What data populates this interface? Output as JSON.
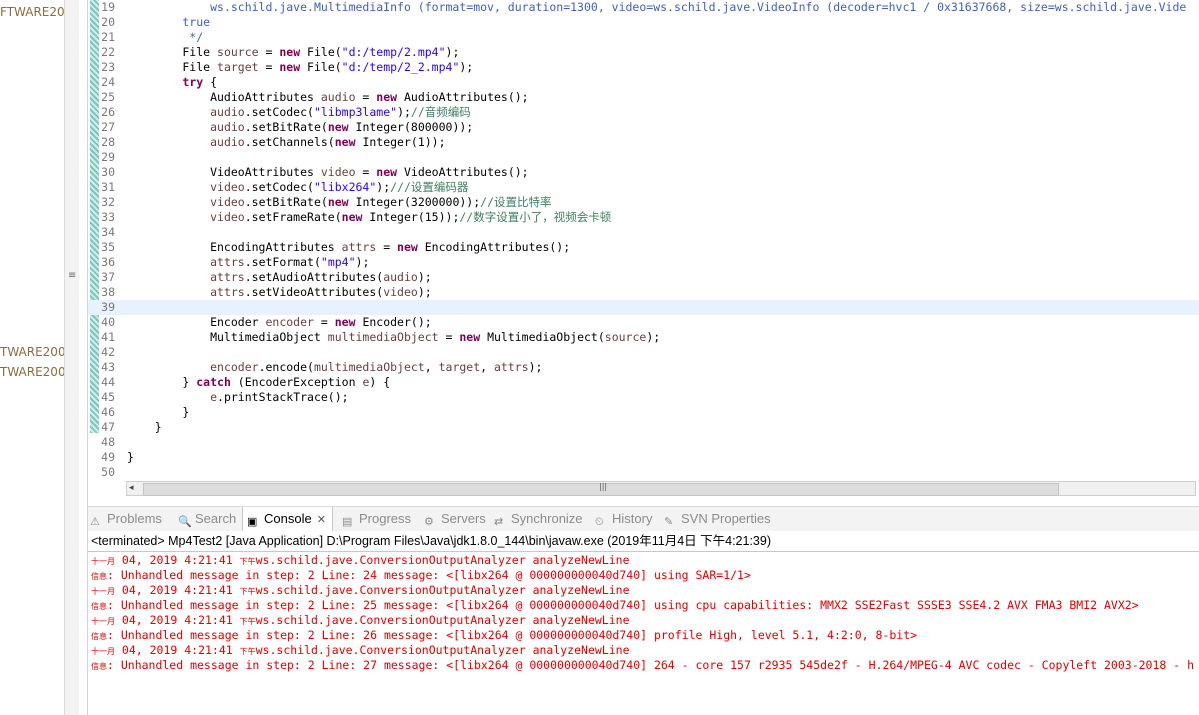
{
  "left_panel": {
    "labels": [
      "FTWARE20",
      "TWARE200",
      "TWARE200"
    ]
  },
  "editor": {
    "lines": [
      {
        "num": "19",
        "segs": [
          [
            "            ",
            ""
          ],
          [
            "ws.schild.jave.MultimediaInfo (format=mov, duration=1300, video=ws.schild.jave.VideoInfo (decoder=hvc1 / 0x31637668, size=ws.schild.jave.Vide",
            "jd"
          ]
        ]
      },
      {
        "num": "20",
        "segs": [
          [
            "        true",
            "jd"
          ]
        ]
      },
      {
        "num": "21",
        "segs": [
          [
            "         */",
            "jd"
          ]
        ]
      },
      {
        "num": "22",
        "segs": [
          [
            "        File ",
            ""
          ],
          [
            "source",
            "var"
          ],
          [
            " = ",
            ""
          ],
          [
            "new",
            "kw"
          ],
          [
            " File(",
            ""
          ],
          [
            "\"d:/temp/2.mp4\"",
            "str"
          ],
          [
            ");",
            ""
          ]
        ]
      },
      {
        "num": "23",
        "segs": [
          [
            "        File ",
            ""
          ],
          [
            "target",
            "var"
          ],
          [
            " = ",
            ""
          ],
          [
            "new",
            "kw"
          ],
          [
            " File(",
            ""
          ],
          [
            "\"d:/temp/2_2.mp4\"",
            "str"
          ],
          [
            ");",
            ""
          ]
        ]
      },
      {
        "num": "24",
        "segs": [
          [
            "        ",
            ""
          ],
          [
            "try",
            "kw"
          ],
          [
            " {",
            ""
          ]
        ]
      },
      {
        "num": "25",
        "segs": [
          [
            "            AudioAttributes ",
            ""
          ],
          [
            "audio",
            "var"
          ],
          [
            " = ",
            ""
          ],
          [
            "new",
            "kw"
          ],
          [
            " AudioAttributes();",
            ""
          ]
        ]
      },
      {
        "num": "26",
        "segs": [
          [
            "            ",
            ""
          ],
          [
            "audio",
            "var"
          ],
          [
            ".setCodec(",
            ""
          ],
          [
            "\"libmp3lame\"",
            "str"
          ],
          [
            ");",
            ""
          ],
          [
            "//音频编码",
            "cm"
          ]
        ]
      },
      {
        "num": "27",
        "segs": [
          [
            "            ",
            ""
          ],
          [
            "audio",
            "var"
          ],
          [
            ".setBitRate(",
            ""
          ],
          [
            "new",
            "kw"
          ],
          [
            " Integer(800000));",
            ""
          ]
        ]
      },
      {
        "num": "28",
        "segs": [
          [
            "            ",
            ""
          ],
          [
            "audio",
            "var"
          ],
          [
            ".setChannels(",
            ""
          ],
          [
            "new",
            "kw"
          ],
          [
            " Integer(1));",
            ""
          ]
        ]
      },
      {
        "num": "29",
        "segs": []
      },
      {
        "num": "30",
        "segs": [
          [
            "            VideoAttributes ",
            ""
          ],
          [
            "video",
            "var"
          ],
          [
            " = ",
            ""
          ],
          [
            "new",
            "kw"
          ],
          [
            " VideoAttributes();",
            ""
          ]
        ]
      },
      {
        "num": "31",
        "segs": [
          [
            "            ",
            ""
          ],
          [
            "video",
            "var"
          ],
          [
            ".setCodec(",
            ""
          ],
          [
            "\"libx264\"",
            "str"
          ],
          [
            ");",
            ""
          ],
          [
            "///设置编码器",
            "cm"
          ]
        ]
      },
      {
        "num": "32",
        "segs": [
          [
            "            ",
            ""
          ],
          [
            "video",
            "var"
          ],
          [
            ".setBitRate(",
            ""
          ],
          [
            "new",
            "kw"
          ],
          [
            " Integer(3200000));",
            ""
          ],
          [
            "//设置比特率",
            "cm"
          ]
        ]
      },
      {
        "num": "33",
        "segs": [
          [
            "            ",
            ""
          ],
          [
            "video",
            "var"
          ],
          [
            ".setFrameRate(",
            ""
          ],
          [
            "new",
            "kw"
          ],
          [
            " Integer(15));",
            ""
          ],
          [
            "//数字设置小了，视频会卡顿",
            "cm"
          ]
        ]
      },
      {
        "num": "34",
        "segs": []
      },
      {
        "num": "35",
        "segs": [
          [
            "            EncodingAttributes ",
            ""
          ],
          [
            "attrs",
            "var"
          ],
          [
            " = ",
            ""
          ],
          [
            "new",
            "kw"
          ],
          [
            " EncodingAttributes();",
            ""
          ]
        ]
      },
      {
        "num": "36",
        "segs": [
          [
            "            ",
            ""
          ],
          [
            "attrs",
            "var"
          ],
          [
            ".setFormat(",
            ""
          ],
          [
            "\"mp4\"",
            "str"
          ],
          [
            ");",
            ""
          ]
        ]
      },
      {
        "num": "37",
        "segs": [
          [
            "            ",
            ""
          ],
          [
            "attrs",
            "var"
          ],
          [
            ".setAudioAttributes(",
            ""
          ],
          [
            "audio",
            "var"
          ],
          [
            ");",
            ""
          ]
        ]
      },
      {
        "num": "38",
        "segs": [
          [
            "            ",
            ""
          ],
          [
            "attrs",
            "var"
          ],
          [
            ".setVideoAttributes(",
            ""
          ],
          [
            "video",
            "var"
          ],
          [
            ");",
            ""
          ]
        ]
      },
      {
        "num": "39",
        "segs": [],
        "current": true
      },
      {
        "num": "40",
        "segs": [
          [
            "            Encoder ",
            ""
          ],
          [
            "encoder",
            "var"
          ],
          [
            " = ",
            ""
          ],
          [
            "new",
            "kw"
          ],
          [
            " Encoder();",
            ""
          ]
        ]
      },
      {
        "num": "41",
        "segs": [
          [
            "            MultimediaObject ",
            ""
          ],
          [
            "multimediaObject",
            "var"
          ],
          [
            " = ",
            ""
          ],
          [
            "new",
            "kw"
          ],
          [
            " MultimediaObject(",
            ""
          ],
          [
            "source",
            "var"
          ],
          [
            ");",
            ""
          ]
        ]
      },
      {
        "num": "42",
        "segs": []
      },
      {
        "num": "43",
        "segs": [
          [
            "            ",
            ""
          ],
          [
            "encoder",
            "var"
          ],
          [
            ".encode(",
            ""
          ],
          [
            "multimediaObject",
            "var"
          ],
          [
            ", ",
            ""
          ],
          [
            "target",
            "var"
          ],
          [
            ", ",
            ""
          ],
          [
            "attrs",
            "var"
          ],
          [
            ");",
            ""
          ]
        ]
      },
      {
        "num": "44",
        "segs": [
          [
            "        } ",
            ""
          ],
          [
            "catch",
            "kw"
          ],
          [
            " (EncoderException ",
            ""
          ],
          [
            "e",
            "var"
          ],
          [
            ") {",
            ""
          ]
        ]
      },
      {
        "num": "45",
        "segs": [
          [
            "            ",
            ""
          ],
          [
            "e",
            "var"
          ],
          [
            ".printStackTrace();",
            ""
          ]
        ]
      },
      {
        "num": "46",
        "segs": [
          [
            "        }",
            ""
          ]
        ]
      },
      {
        "num": "47",
        "segs": [
          [
            "    }",
            ""
          ]
        ]
      },
      {
        "num": "48",
        "segs": []
      },
      {
        "num": "49",
        "segs": [
          [
            "}",
            ""
          ]
        ]
      },
      {
        "num": "50",
        "segs": []
      }
    ]
  },
  "tabs": [
    {
      "label": "Problems",
      "icon": "problems-icon",
      "active": false
    },
    {
      "label": "Search",
      "icon": "search-icon",
      "active": false
    },
    {
      "label": "Console",
      "icon": "console-icon",
      "active": true
    },
    {
      "label": "Progress",
      "icon": "progress-icon",
      "active": false
    },
    {
      "label": "Servers",
      "icon": "servers-icon",
      "active": false
    },
    {
      "label": "Synchronize",
      "icon": "synchronize-icon",
      "active": false
    },
    {
      "label": "History",
      "icon": "history-icon",
      "active": false
    },
    {
      "label": "SVN Properties",
      "icon": "svn-properties-icon",
      "active": false
    }
  ],
  "console": {
    "header": "<terminated> Mp4Test2 [Java Application] D:\\Program Files\\Java\\jdk1.8.0_144\\bin\\javaw.exe (2019年11月4日 下午4:21:39)",
    "lines": [
      {
        "cj": "十一月",
        "text": " 04, 2019 4:21:41 ",
        "cj2": "下午",
        "text2": "ws.schild.jave.ConversionOutputAnalyzer analyzeNewLine"
      },
      {
        "cj": "信息",
        "text": ": Unhandled message in step: 2 Line: 24 message: <[libx264 @ 000000000040d740] using SAR=1/1>",
        "cj2": "",
        "text2": ""
      },
      {
        "cj": "十一月",
        "text": " 04, 2019 4:21:41 ",
        "cj2": "下午",
        "text2": "ws.schild.jave.ConversionOutputAnalyzer analyzeNewLine"
      },
      {
        "cj": "信息",
        "text": ": Unhandled message in step: 2 Line: 25 message: <[libx264 @ 000000000040d740] using cpu capabilities: MMX2 SSE2Fast SSSE3 SSE4.2 AVX FMA3 BMI2 AVX2>",
        "cj2": "",
        "text2": ""
      },
      {
        "cj": "十一月",
        "text": " 04, 2019 4:21:41 ",
        "cj2": "下午",
        "text2": "ws.schild.jave.ConversionOutputAnalyzer analyzeNewLine"
      },
      {
        "cj": "信息",
        "text": ": Unhandled message in step: 2 Line: 26 message: <[libx264 @ 000000000040d740] profile High, level 5.1, 4:2:0, 8-bit>",
        "cj2": "",
        "text2": ""
      },
      {
        "cj": "十一月",
        "text": " 04, 2019 4:21:41 ",
        "cj2": "下午",
        "text2": "ws.schild.jave.ConversionOutputAnalyzer analyzeNewLine"
      },
      {
        "cj": "信息",
        "text": ": Unhandled message in step: 2 Line: 27 message: <[libx264 @ 000000000040d740] 264 - core 157 r2935 545de2f - H.264/MPEG-4 AVC codec - Copyleft 2003-2018 - h",
        "cj2": "",
        "text2": ""
      }
    ]
  },
  "colors": {
    "keyword": "#7f0055",
    "string": "#2a00ff",
    "comment": "#3f7f5f",
    "variable": "#6a3e3e",
    "javadoc": "#3f5fbf",
    "console_error": "#e00000"
  }
}
